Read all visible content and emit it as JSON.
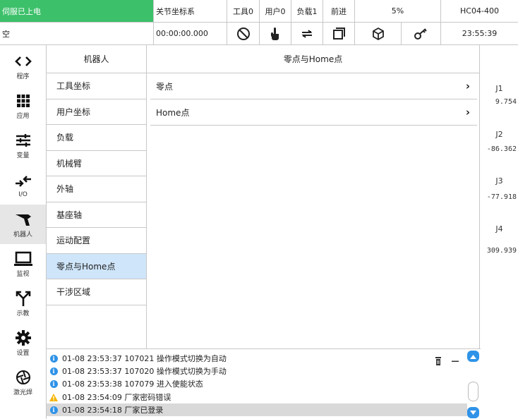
{
  "status_bar": {
    "servo_status": "伺服已上电",
    "coord_system": "关节坐标系",
    "tool": "工具0",
    "user": "用户0",
    "payload": "负载1",
    "direction": "前进",
    "speed": "5%",
    "model": "HC04-400",
    "program": "空",
    "run_time": "00:00:00.000",
    "clock": "23:55:39",
    "icons": [
      "stop-icon",
      "hand-icon",
      "loop-icon",
      "window-icon",
      "cube-icon",
      "key-icon"
    ]
  },
  "nav": [
    {
      "label": "程序",
      "icon": "code-icon"
    },
    {
      "label": "应用",
      "icon": "grid-icon"
    },
    {
      "label": "变量",
      "icon": "sliders-icon"
    },
    {
      "label": "I/O",
      "icon": "io-icon"
    },
    {
      "label": "机器人",
      "icon": "robot-arm-icon",
      "active": true
    },
    {
      "label": "监视",
      "icon": "monitor-icon"
    },
    {
      "label": "示教",
      "icon": "teach-icon"
    },
    {
      "label": "设置",
      "icon": "gear-icon"
    },
    {
      "label": "激光焊",
      "icon": "laser-weld-icon"
    }
  ],
  "menu": {
    "title": "机器人",
    "items": [
      "工具坐标",
      "用户坐标",
      "负载",
      "机械臂",
      "外轴",
      "基座轴",
      "运动配置",
      "零点与Home点",
      "干涉区域"
    ],
    "selected": "零点与Home点"
  },
  "main": {
    "title": "零点与Home点",
    "rows": [
      "零点",
      "Home点"
    ]
  },
  "joints": [
    {
      "name": "J1",
      "value": "9.754"
    },
    {
      "name": "J2",
      "value": "-86.362"
    },
    {
      "name": "J3",
      "value": "-77.918"
    },
    {
      "name": "J4",
      "value": "309.939"
    }
  ],
  "log": [
    {
      "level": "info",
      "text": "01-08 23:53:37 107021 操作模式切换为自动"
    },
    {
      "level": "info",
      "text": "01-08 23:53:37 107020 操作模式切换为手动"
    },
    {
      "level": "info",
      "text": "01-08 23:53:38 107079 进入使能状态"
    },
    {
      "level": "warning",
      "text": "01-08 23:54:09 厂家密码错误"
    },
    {
      "level": "info",
      "text": "01-08 23:54:18 厂家已登录",
      "highlighted": true
    }
  ],
  "colors": {
    "servo_on": "#3cc06a",
    "selected": "#cfe5fa",
    "info": "#2f93e8",
    "warning": "#f5b400"
  }
}
